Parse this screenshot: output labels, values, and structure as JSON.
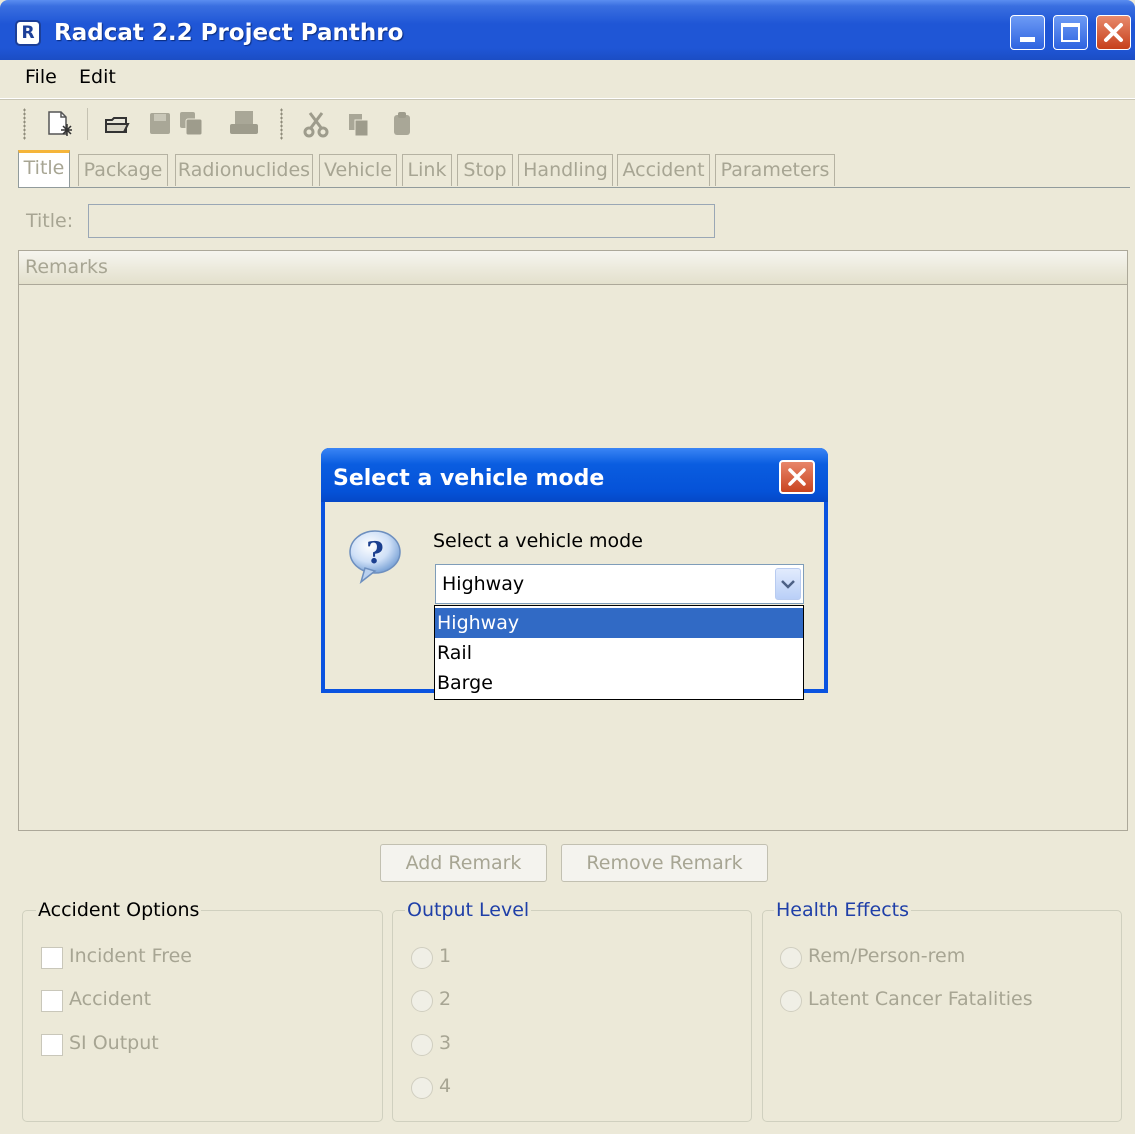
{
  "window": {
    "title": "Radcat 2.2 Project Panthro",
    "app_icon_glyph": "R"
  },
  "menu": {
    "file": "File",
    "edit": "Edit"
  },
  "toolbar": {
    "icons": [
      "new-file-icon",
      "open-icon",
      "save-icon",
      "save-all-icon",
      "print-icon",
      "cut-icon",
      "copy-icon",
      "paste-icon"
    ]
  },
  "tabs": [
    "Title",
    "Package",
    "Radionuclides",
    "Vehicle",
    "Link",
    "Stop",
    "Handling",
    "Accident",
    "Parameters"
  ],
  "form": {
    "title_label": "Title:",
    "title_value": "",
    "remarks_header": "Remarks"
  },
  "buttons": {
    "add_remark": "Add Remark",
    "remove_remark": "Remove Remark"
  },
  "accident_options": {
    "title": "Accident Options",
    "items": [
      "Incident Free",
      "Accident",
      "SI Output"
    ]
  },
  "output_level": {
    "title": "Output Level",
    "items": [
      "1",
      "2",
      "3",
      "4"
    ]
  },
  "health_effects": {
    "title": "Health Effects",
    "items": [
      "Rem/Person-rem",
      "Latent Cancer Fatalities"
    ]
  },
  "dialog": {
    "title": "Select a vehicle mode",
    "message": "Select a vehicle mode",
    "selected": "Highway",
    "options": [
      "Highway",
      "Rail",
      "Barge"
    ],
    "highlighted_index": 0
  },
  "colors": {
    "title_bar": "#1f56d6",
    "dialog_title": "#0552d8",
    "selection": "#316ac5",
    "disabled_text": "#a7a593",
    "group_title_blue": "#1f3fa8",
    "active_tab_accent": "#f5b53a"
  }
}
